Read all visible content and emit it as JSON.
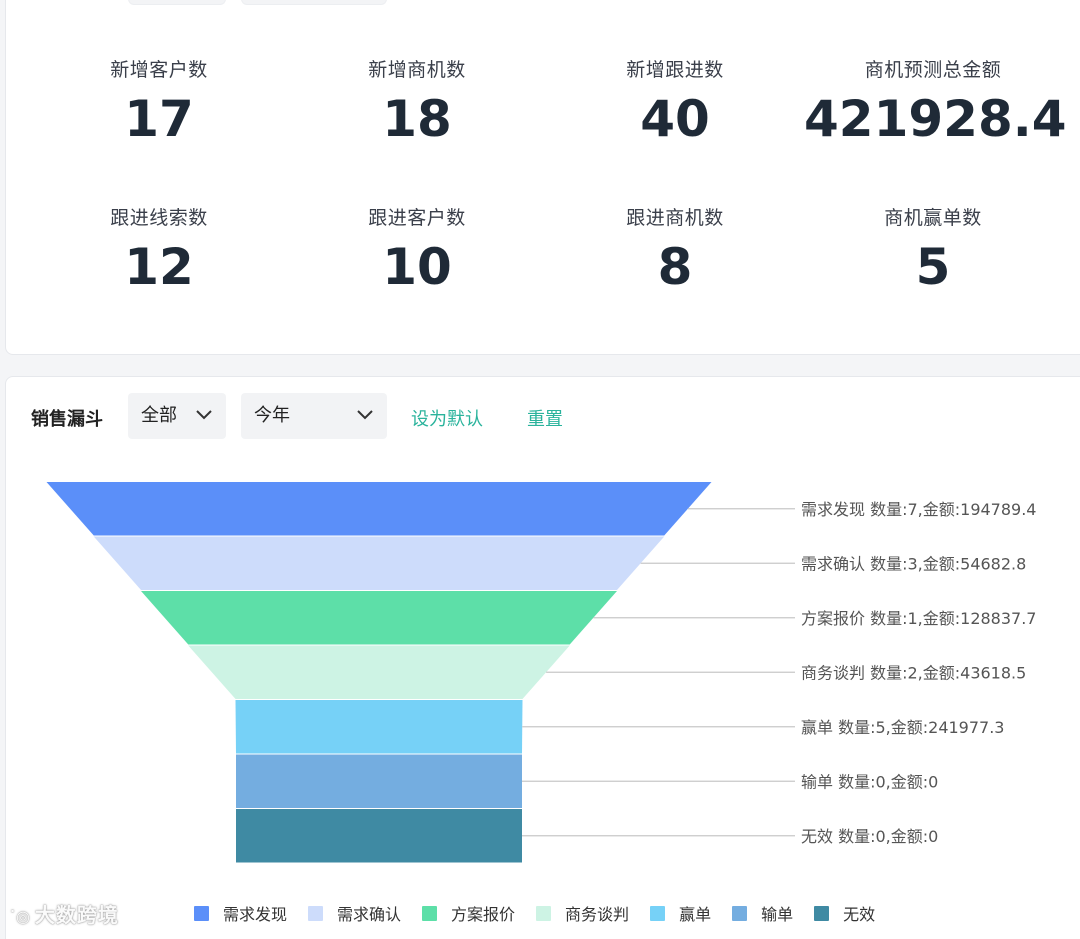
{
  "stats": [
    {
      "label": "新增客户数",
      "value": "17"
    },
    {
      "label": "新增商机数",
      "value": "18"
    },
    {
      "label": "新增跟进数",
      "value": "40"
    },
    {
      "label": "商机预测总金额",
      "value": "421928.4"
    },
    {
      "label": "跟进线索数",
      "value": "12"
    },
    {
      "label": "跟进客户数",
      "value": "10"
    },
    {
      "label": "跟进商机数",
      "value": "8"
    },
    {
      "label": "商机赢单数",
      "value": "5"
    }
  ],
  "funnel_toolbar": {
    "title": "销售漏斗",
    "scope_select": "全部",
    "period_select": "今年",
    "set_default_label": "设为默认",
    "reset_label": "重置"
  },
  "chart_data": {
    "type": "funnel",
    "title": "销售漏斗",
    "series": [
      {
        "name": "需求发现",
        "label": "需求发现 数量:7,金额:194789.4",
        "count": 7,
        "amount": 194789.4,
        "color": "#5b8ff9"
      },
      {
        "name": "需求确认",
        "label": "需求确认 数量:3,金额:54682.8",
        "count": 3,
        "amount": 54682.8,
        "color": "#cddcfb"
      },
      {
        "name": "方案报价",
        "label": "方案报价 数量:1,金额:128837.7",
        "count": 1,
        "amount": 128837.7,
        "color": "#5ddfa8"
      },
      {
        "name": "商务谈判",
        "label": "商务谈判 数量:2,金额:43618.5",
        "count": 2,
        "amount": 43618.5,
        "color": "#cdf3e4"
      },
      {
        "name": "赢单",
        "label": "赢单 数量:5,金额:241977.3",
        "count": 5,
        "amount": 241977.3,
        "color": "#76d1f7"
      },
      {
        "name": "输单",
        "label": "输单 数量:0,金额:0",
        "count": 0,
        "amount": 0,
        "color": "#74ade0"
      },
      {
        "name": "无效",
        "label": "无效 数量:0,金额:0",
        "count": 0,
        "amount": 0,
        "color": "#3f8aa3"
      }
    ],
    "legend_position": "bottom"
  },
  "watermark": "大数跨境"
}
